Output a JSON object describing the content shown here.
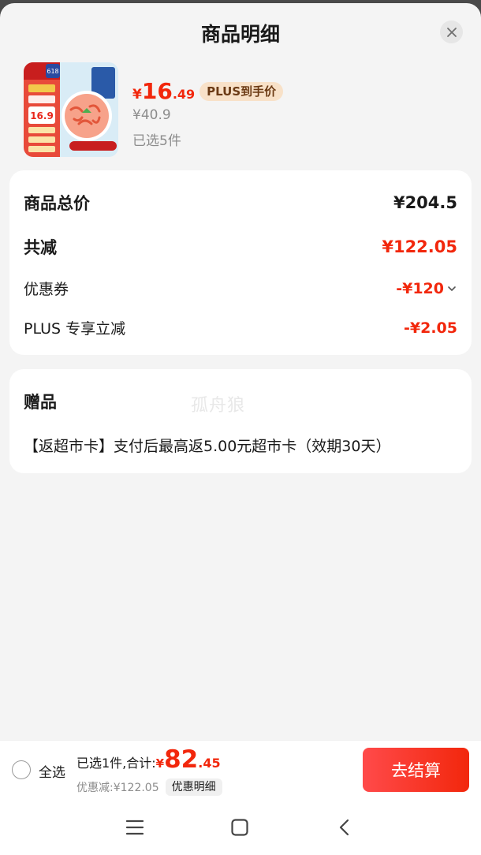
{
  "sheet": {
    "title": "商品明细",
    "close_icon": "close-icon"
  },
  "product": {
    "price_symbol": "¥",
    "price_integer": "16",
    "price_decimal": ".49",
    "plus_tag": "PLUS到手价",
    "original_price": "¥40.9",
    "selected_count": "已选5件",
    "thumb_badge": "618",
    "thumb_price": "16.9"
  },
  "summary": {
    "total_label": "商品总价",
    "total_value": "¥204.5",
    "reduce_label": "共减",
    "reduce_value": "¥122.05",
    "coupon_label": "优惠券",
    "coupon_value": "-¥120",
    "plus_label": "PLUS 专享立减",
    "plus_value": "-¥2.05"
  },
  "gift": {
    "title": "赠品",
    "text": "【返超市卡】支付后最高返5.00元超市卡（效期30天）",
    "watermark": "孤舟狼"
  },
  "bottom_bar": {
    "select_all_label": "全选",
    "total_prefix": "已选1件,合计:",
    "total_symbol": "¥",
    "total_integer": "82",
    "total_decimal": ".45",
    "discount_text": "优惠减:¥122.05",
    "detail_chip": "优惠明细",
    "checkout_label": "去结算"
  },
  "navbar": {
    "menu_icon": "menu-icon",
    "home_icon": "home-icon",
    "back_icon": "back-icon"
  },
  "colors": {
    "accent_red": "#f2270c",
    "plus_tag_bg": "#f8e1c8",
    "background": "#f4f4f4"
  }
}
